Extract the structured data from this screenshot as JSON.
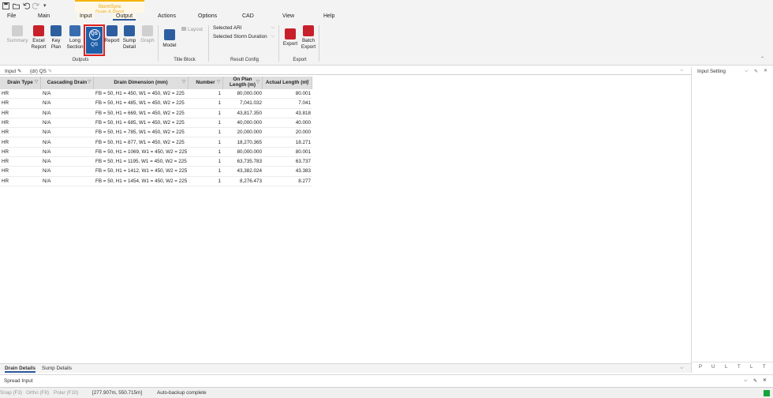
{
  "contextual_tab": {
    "line1": "StormSync",
    "line2": "Drain & Pond"
  },
  "tabs": [
    "File",
    "Main",
    "Input",
    "Output",
    "Actions",
    "Options",
    "CAD",
    "View",
    "Help"
  ],
  "ribbon": {
    "outputs": {
      "summary": "Summary",
      "excel_report": [
        "Excel",
        "Report"
      ],
      "key_plan": [
        "Key",
        "Plan"
      ],
      "long_section": [
        "Long",
        "Section"
      ],
      "qs": "QS",
      "report": "Report",
      "sump_detail": [
        "Sump",
        "Detail"
      ],
      "graph": "Graph",
      "group_label": "Outputs"
    },
    "title_block": {
      "model": "Model",
      "layout": "Layout",
      "group_label": "Title Block"
    },
    "result_config": {
      "selected_ari": "Selected ARI",
      "selected_storm_duration": "Selected Storm Duration",
      "group_label": "Result Config"
    },
    "export": {
      "export": "Export",
      "batch_export": [
        "Batch",
        "Export"
      ],
      "group_label": "Export"
    }
  },
  "doc_tabs": {
    "input": "Input",
    "active": "(dr) QS"
  },
  "grid": {
    "headers": {
      "drain_type": "Drain Type",
      "cascading_drain": "Cascading Drain",
      "drain_dimension": "Drain Dimension (mm)",
      "number": "Number",
      "on_plan_length_1": "On Plan",
      "on_plan_length_2": "Length (m)",
      "actual_length": "Actual Length (m)"
    },
    "rows": [
      {
        "type": "HR",
        "cascading": "N/A",
        "dimension": "FB = 50, H1 = 450, W1 = 450, W2 = 225",
        "number": "1",
        "on_plan": "80,000.000",
        "actual": "80.001"
      },
      {
        "type": "HR",
        "cascading": "N/A",
        "dimension": "FB = 50, H1 = 485, W1 = 450, W2 = 225",
        "number": "1",
        "on_plan": "7,041.032",
        "actual": "7.041"
      },
      {
        "type": "HR",
        "cascading": "N/A",
        "dimension": "FB = 50, H1 = 669, W1 = 450, W2 = 225",
        "number": "1",
        "on_plan": "43,817.350",
        "actual": "43.818"
      },
      {
        "type": "HR",
        "cascading": "N/A",
        "dimension": "FB = 50, H1 = 685, W1 = 450, W2 = 225",
        "number": "1",
        "on_plan": "40,000.000",
        "actual": "40.000"
      },
      {
        "type": "HR",
        "cascading": "N/A",
        "dimension": "FB = 50, H1 = 785, W1 = 450, W2 = 225",
        "number": "1",
        "on_plan": "20,000.000",
        "actual": "20.000"
      },
      {
        "type": "HR",
        "cascading": "N/A",
        "dimension": "FB = 50, H1 = 877, W1 = 450, W2 = 225",
        "number": "1",
        "on_plan": "18,270.365",
        "actual": "18.271"
      },
      {
        "type": "HR",
        "cascading": "N/A",
        "dimension": "FB = 50, H1 = 1069, W1 = 450, W2 = 225",
        "number": "1",
        "on_plan": "80,000.000",
        "actual": "80.001"
      },
      {
        "type": "HR",
        "cascading": "N/A",
        "dimension": "FB = 50, H1 = 1195, W1 = 450, W2 = 225",
        "number": "1",
        "on_plan": "63,735.783",
        "actual": "63.737"
      },
      {
        "type": "HR",
        "cascading": "N/A",
        "dimension": "FB = 50, H1 = 1412, W1 = 450, W2 = 225",
        "number": "1",
        "on_plan": "43,382.024",
        "actual": "43.383"
      },
      {
        "type": "HR",
        "cascading": "N/A",
        "dimension": "FB = 50, H1 = 1454, W1 = 450, W2 = 225",
        "number": "1",
        "on_plan": "8,276.473",
        "actual": "8.277"
      }
    ]
  },
  "right_panel": {
    "title": "Input Setting",
    "footer_letters": [
      "P",
      "U",
      "L",
      "T",
      "L",
      "T"
    ]
  },
  "bottom_tabs": {
    "drain_details": "Drain Details",
    "sump_details": "Sump Details"
  },
  "spread_input": "Spread Input",
  "status_bar": {
    "snap": "Snap (F3)",
    "ortho": "Ortho (F8)",
    "polar": "Polar (F10)",
    "coords": "[277.907m, 550.715m]",
    "message": "Auto-backup complete"
  },
  "colors": {
    "accent": "#2b579a",
    "qs_button": "#1f5fa8",
    "highlight_border": "#e02020",
    "contextual": "#f5b400",
    "status_ok": "#12a53a"
  }
}
